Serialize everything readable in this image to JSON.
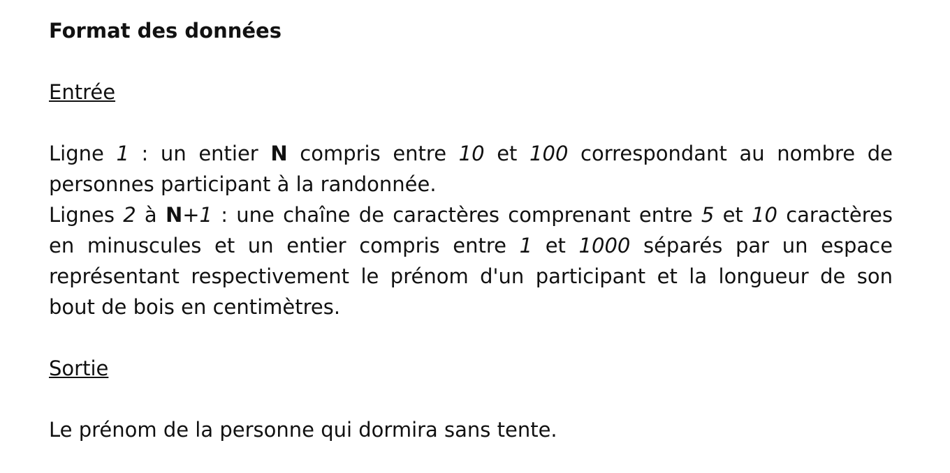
{
  "title": "Format des données",
  "input_section": {
    "heading": "Entrée",
    "line1": {
      "p1": "Ligne ",
      "num1": "1",
      "p2": " : un entier ",
      "N": "N",
      "p3": " compris entre ",
      "min": "10",
      "p4": " et ",
      "max": "100",
      "p5": " correspondant au nombre de personnes participant à la randonnée."
    },
    "line2": {
      "p1": "Lignes ",
      "num2": "2",
      "p2": " à ",
      "N": "N",
      "plus": "+",
      "num1": "1",
      "p3": " : une chaîne de caractères comprenant entre ",
      "min_chars": "5",
      "p4": " et ",
      "max_chars": "10",
      "p5": " caractères en minuscules et un entier compris entre ",
      "min_len": "1",
      "p6": " et ",
      "max_len": "1000",
      "p7": " séparés par un espace représentant respectivement le prénom d'un participant et la longueur de son bout de bois en centimètres."
    }
  },
  "output_section": {
    "heading": "Sortie",
    "text": "Le prénom de la personne qui dormira sans tente."
  }
}
